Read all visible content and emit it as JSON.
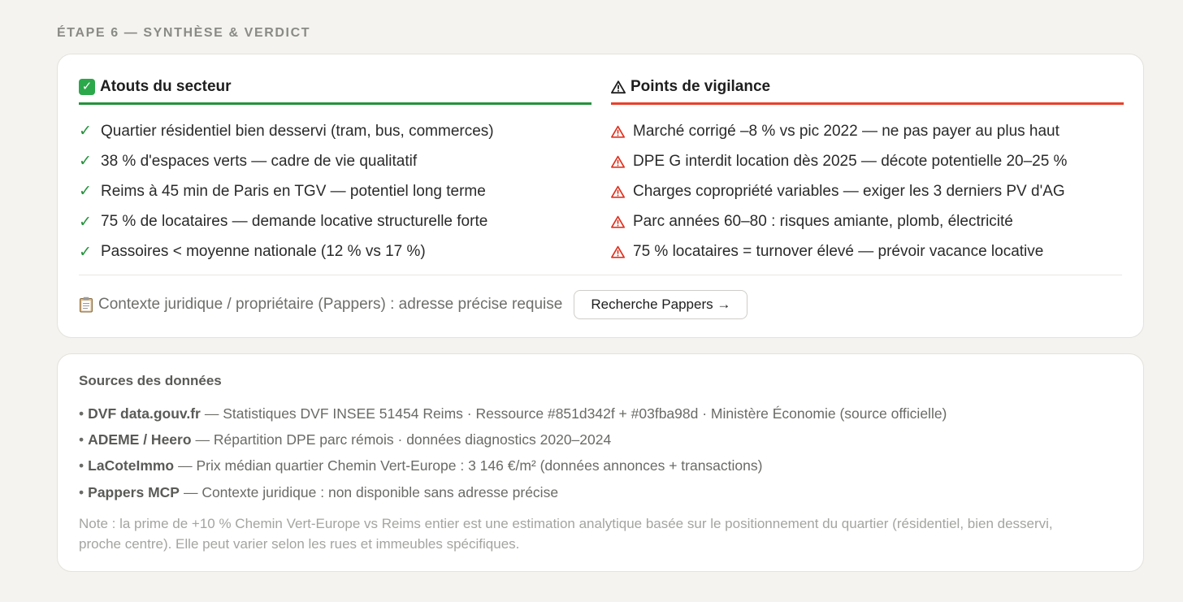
{
  "step_title": "ÉTAPE 6 — SYNTHÈSE & VERDICT",
  "strengths": {
    "title": "Atouts du secteur",
    "icon": "check-badge-icon",
    "accent_color": "#24923c",
    "items": [
      "Quartier résidentiel bien desservi (tram, bus, commerces)",
      "38 % d'espaces verts — cadre de vie qualitatif",
      "Reims à 45 min de Paris en TGV — potentiel long terme",
      "75 % de locataires — demande locative structurelle forte",
      "Passoires < moyenne nationale (12 % vs 17 %)"
    ]
  },
  "warnings": {
    "title": "Points de vigilance",
    "icon": "warning-icon",
    "accent_color": "#e8412c",
    "items": [
      "Marché corrigé –8 % vs pic 2022 — ne pas payer au plus haut",
      "DPE G interdit location dès 2025 — décote potentielle 20–25 %",
      "Charges copropriété variables — exiger les 3 derniers PV d'AG",
      "Parc années 60–80 : risques amiante, plomb, électricité",
      "75 % locataires = turnover élevé — prévoir vacance locative"
    ]
  },
  "footer": {
    "context_text": "Contexte juridique / propriétaire (Pappers) : adresse précise requise",
    "icon": "clipboard-icon",
    "button_label": "Recherche Pappers →"
  },
  "sources": {
    "title": "Sources des données",
    "items": [
      {
        "name": "DVF data.gouv.fr",
        "detail": "— Statistiques DVF INSEE 51454 Reims · Ressource #851d342f + #03fba98d · Ministère Économie (source officielle)"
      },
      {
        "name": "ADEME / Heero",
        "detail": "— Répartition DPE parc rémois · données diagnostics 2020–2024"
      },
      {
        "name": "LaCoteImmo",
        "detail": "— Prix médian quartier Chemin Vert-Europe : 3 146 €/m² (données annonces + transactions)"
      },
      {
        "name": "Pappers MCP",
        "detail": "— Contexte juridique : non disponible sans adresse précise"
      }
    ],
    "note": "Note : la prime de +10 % Chemin Vert-Europe vs Reims entier est une estimation analytique basée sur le positionnement du quartier (résidentiel, bien desservi, proche centre). Elle peut varier selon les rues et immeubles spécifiques."
  }
}
